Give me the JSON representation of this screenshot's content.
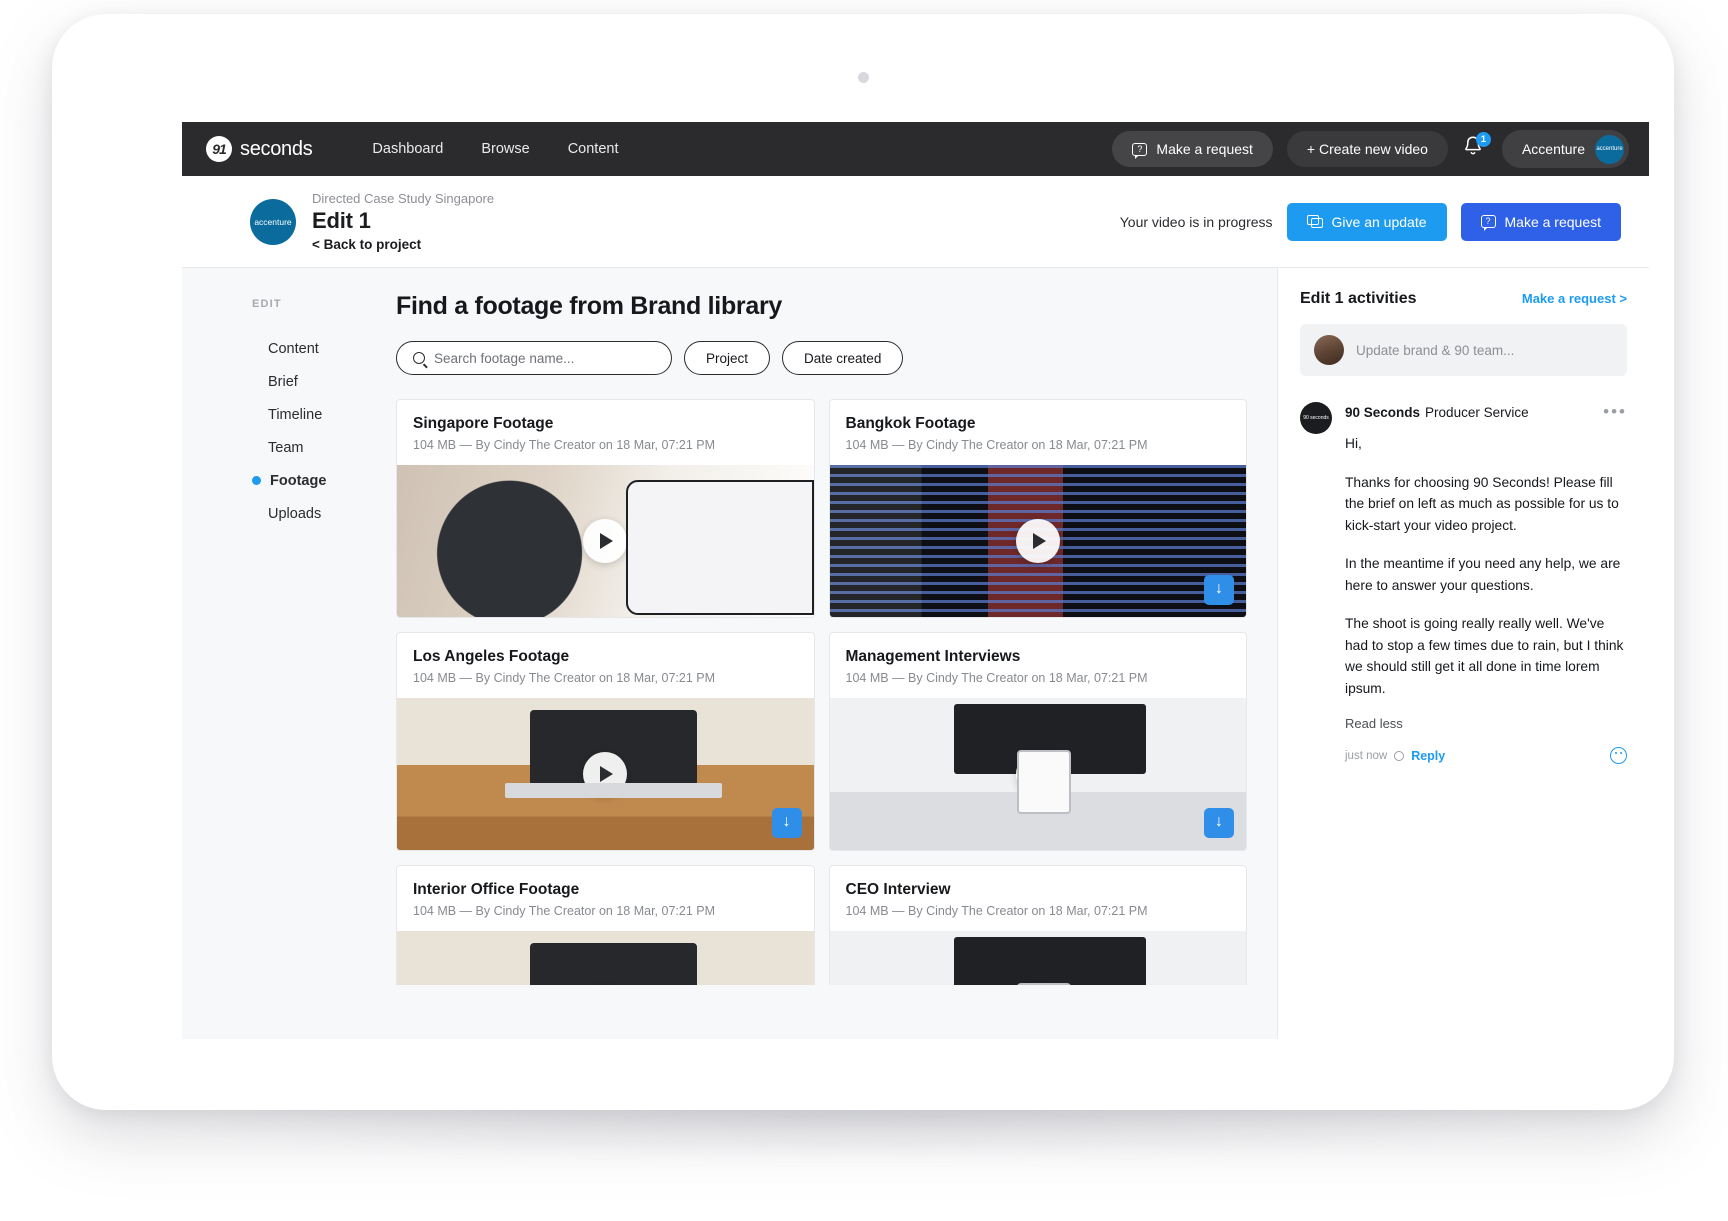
{
  "topnav": {
    "brand_mark": "91",
    "brand_name": "seconds",
    "links": [
      {
        "label": "Dashboard"
      },
      {
        "label": "Browse"
      },
      {
        "label": "Content"
      }
    ],
    "make_request_label": "Make a request",
    "create_video_label": "+ Create new video",
    "notification_count": "1",
    "account_name": "Accenture",
    "account_avatar_text": "accenture"
  },
  "project_header": {
    "logo_text": "accenture",
    "parent": "Directed Case Study Singapore",
    "title": "Edit 1",
    "back_label": "< Back to project",
    "status": "Your video is in progress",
    "give_update_label": "Give an update",
    "make_request_label": "Make a request"
  },
  "sidebar": {
    "heading": "EDIT",
    "items": [
      {
        "label": "Content",
        "active": false
      },
      {
        "label": "Brief",
        "active": false
      },
      {
        "label": "Timeline",
        "active": false
      },
      {
        "label": "Team",
        "active": false
      },
      {
        "label": "Footage",
        "active": true
      },
      {
        "label": "Uploads",
        "active": false
      }
    ]
  },
  "main": {
    "title": "Find a footage from Brand library",
    "search_placeholder": "Search footage name...",
    "filters": [
      {
        "label": "Project"
      },
      {
        "label": "Date created"
      }
    ],
    "cards": [
      {
        "title": "Singapore Footage",
        "meta": "104 MB — By Cindy The Creator on 18 Mar, 07:21 PM",
        "thumb": "thumb-speaker"
      },
      {
        "title": "Bangkok Footage",
        "meta": "104 MB — By Cindy The Creator on 18 Mar, 07:21 PM",
        "thumb": "thumb-timeline"
      },
      {
        "title": "Los Angeles Footage",
        "meta": "104 MB — By Cindy The Creator on 18 Mar, 07:21 PM",
        "thumb": "thumb-desk"
      },
      {
        "title": "Management Interviews",
        "meta": "104 MB — By Cindy The Creator on 18 Mar, 07:21 PM",
        "thumb": "thumb-monitor"
      },
      {
        "title": "Interior Office Footage",
        "meta": "104 MB — By Cindy The Creator on 18 Mar, 07:21 PM",
        "thumb": "thumb-desk"
      },
      {
        "title": "CEO Interview",
        "meta": "104 MB — By Cindy The Creator on 18 Mar, 07:21 PM",
        "thumb": "thumb-monitor"
      }
    ]
  },
  "activities": {
    "title": "Edit 1 activities",
    "link_label": "Make a request >",
    "composer_placeholder": "Update brand & 90 team...",
    "message": {
      "author": "90 Seconds",
      "role": "Producer Service",
      "avatar_text": "90 seconds",
      "more_glyph": "•••",
      "paragraphs": [
        "Hi,",
        "Thanks for choosing 90 Seconds! Please fill the brief on left as much as possible for us to kick-start your video project.",
        "In the meantime if you need any help, we are here to answer your questions.",
        "The shoot is going really really well. We've had to stop a few times due to rain, but I think we should still get it all done in time lorem ipsum."
      ],
      "read_less_label": "Read less",
      "time": "just now",
      "reply_label": "Reply"
    }
  },
  "colors": {
    "nav_bg": "#2b2b2e",
    "accent_cyan": "#1d9bf0",
    "accent_blue": "#2f61e8",
    "brand_navy": "#0a6b9c"
  }
}
